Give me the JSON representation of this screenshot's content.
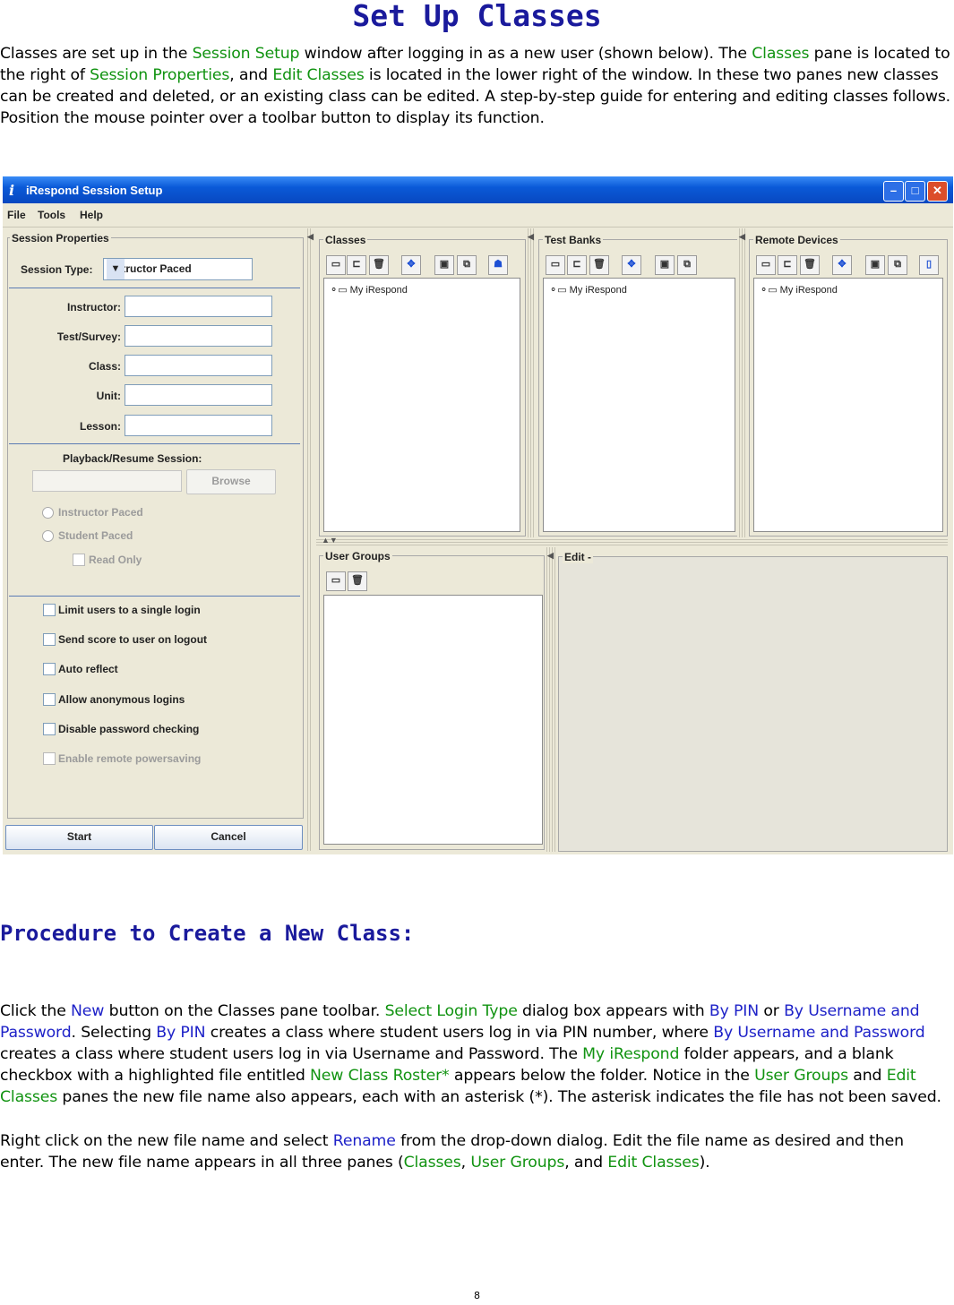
{
  "doc": {
    "title": "Set Up Classes",
    "intro": [
      {
        "t": "Classes are set up in the "
      },
      {
        "t": "Session Setup",
        "c": "g"
      },
      {
        "t": " window after logging in as a new user (shown below).  The "
      },
      {
        "t": "Classes",
        "c": "g"
      },
      {
        "t": " pane is located to the right of "
      },
      {
        "t": "Session Properties",
        "c": "g"
      },
      {
        "t": ", and "
      },
      {
        "t": "Edit Classes",
        "c": "g"
      },
      {
        "t": " is located in the lower right of the window.  In these two panes new classes can be created and deleted, or an existing class can be edited.  A step-by-step guide for entering and editing classes follows.  Position the mouse pointer over a toolbar button to display its function."
      }
    ],
    "procedure_heading": "Procedure to Create a New Class:",
    "procedure_p1": [
      {
        "t": "Click the "
      },
      {
        "t": "New",
        "c": "b"
      },
      {
        "t": " button on the Classes pane toolbar.  "
      },
      {
        "t": "Select Login Type",
        "c": "g"
      },
      {
        "t": " dialog box appears with "
      },
      {
        "t": "By PIN",
        "c": "b"
      },
      {
        "t": " or "
      },
      {
        "t": "By Username and Password",
        "c": "b"
      },
      {
        "t": ".  Selecting "
      },
      {
        "t": "By PIN",
        "c": "b"
      },
      {
        "t": " creates a class where student users log in via PIN number, where "
      },
      {
        "t": "By Username and Password",
        "c": "b"
      },
      {
        "t": " creates a class where student users log in via Username and Password.  The "
      },
      {
        "t": "My iRespond",
        "c": "g"
      },
      {
        "t": " folder appears, and a blank checkbox with a highlighted file entitled "
      },
      {
        "t": "New Class Roster*",
        "c": "g"
      },
      {
        "t": " appears below the folder.  Notice in the "
      },
      {
        "t": "User Groups",
        "c": "g"
      },
      {
        "t": " and "
      },
      {
        "t": "Edit Classes",
        "c": "g"
      },
      {
        "t": " panes the new file name also appears, each with an asterisk (*).  The asterisk indicates the file has not been saved."
      }
    ],
    "procedure_p2": [
      {
        "t": "Right click on the new file name and select "
      },
      {
        "t": "Rename",
        "c": "b"
      },
      {
        "t": " from the drop-down dialog.  Edit the file name as desired and then enter.  The new file name appears in all three panes ("
      },
      {
        "t": "Classes",
        "c": "g"
      },
      {
        "t": ", "
      },
      {
        "t": "User Groups",
        "c": "g"
      },
      {
        "t": ", and "
      },
      {
        "t": "Edit Classes",
        "c": "g"
      },
      {
        "t": ")."
      }
    ],
    "page_number": "8"
  },
  "colors": {
    "title": "#1a1a9c",
    "green_term": "#119311",
    "blue_term": "#1e22c8"
  },
  "window": {
    "title": "iRespond Session Setup",
    "menu": [
      "File",
      "Tools",
      "Help"
    ],
    "session_properties": {
      "group_label": "Session Properties",
      "session_type_label": "Session Type:",
      "session_type_value": "Instructor Paced",
      "fields": [
        "Instructor:",
        "Test/Survey:",
        "Class:",
        "Unit:",
        "Lesson:"
      ],
      "playback_label": "Playback/Resume Session:",
      "browse_label": "Browse",
      "radios": [
        "Instructor Paced",
        "Student Paced"
      ],
      "read_only_label": "Read Only",
      "checkboxes": [
        "Limit users to a single login",
        "Send score to user on logout",
        "Auto reflect",
        "Allow anonymous logins",
        "Disable password checking",
        "Enable remote powersaving"
      ],
      "start_label": "Start",
      "cancel_label": "Cancel"
    },
    "panes": {
      "classes": {
        "label": "Classes",
        "tree_item": "My iRespond"
      },
      "test_banks": {
        "label": "Test Banks",
        "tree_item": "My iRespond"
      },
      "remote_devices": {
        "label": "Remote Devices",
        "tree_item": "My iRespond"
      },
      "user_groups": {
        "label": "User Groups"
      },
      "edit": {
        "label": "Edit -"
      }
    }
  }
}
